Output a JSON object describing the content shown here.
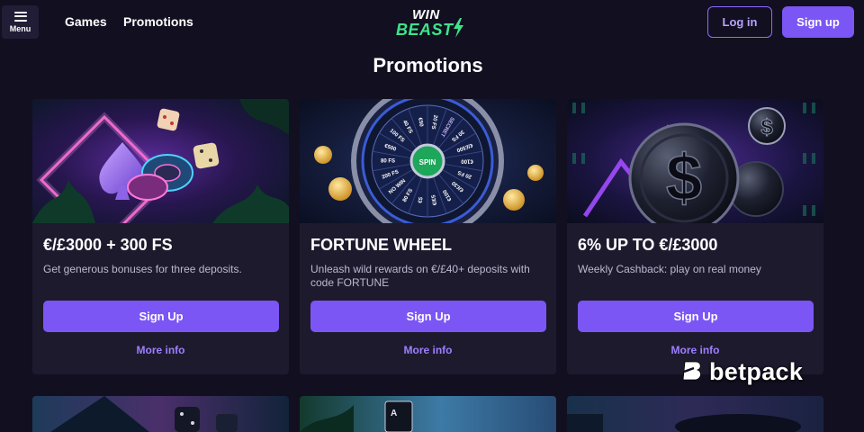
{
  "header": {
    "menu_label": "Menu",
    "nav": [
      {
        "label": "Games"
      },
      {
        "label": "Promotions"
      }
    ],
    "logo_top": "WIN",
    "logo_bottom": "BEAST",
    "login_label": "Log in",
    "signup_label": "Sign up"
  },
  "page": {
    "title": "Promotions"
  },
  "promotions": [
    {
      "title": "€/£3000 + 300 FS",
      "description": "Get generous bonuses for three deposits.",
      "button_label": "Sign Up",
      "more_label": "More info"
    },
    {
      "title": "FORTUNE WHEEL",
      "description": "Unleash wild rewards on €/£40+ deposits with code FORTUNE",
      "button_label": "Sign Up",
      "more_label": "More info",
      "wheel_labels": [
        "20 FS",
        "SECRET",
        "30 FS",
        "€/£500",
        "€100",
        "20 FS",
        "€/£30",
        "€100",
        "€/£5",
        "€5",
        "80 FS",
        "NO WIN",
        "200 FS",
        "80 FS",
        "€500",
        "100 FS",
        "40 FS",
        "€50"
      ],
      "wheel_center": "SPIN"
    },
    {
      "title": "6% UP TO €/£3000",
      "description": "Weekly Cashback: play on real money",
      "button_label": "Sign Up",
      "more_label": "More info"
    }
  ],
  "watermark": {
    "text": "betpack"
  },
  "colors": {
    "background": "#120f21",
    "card": "#1e1a2e",
    "accent": "#7b56f5",
    "link": "#9c7fff",
    "logo_green": "#3ee48a"
  }
}
